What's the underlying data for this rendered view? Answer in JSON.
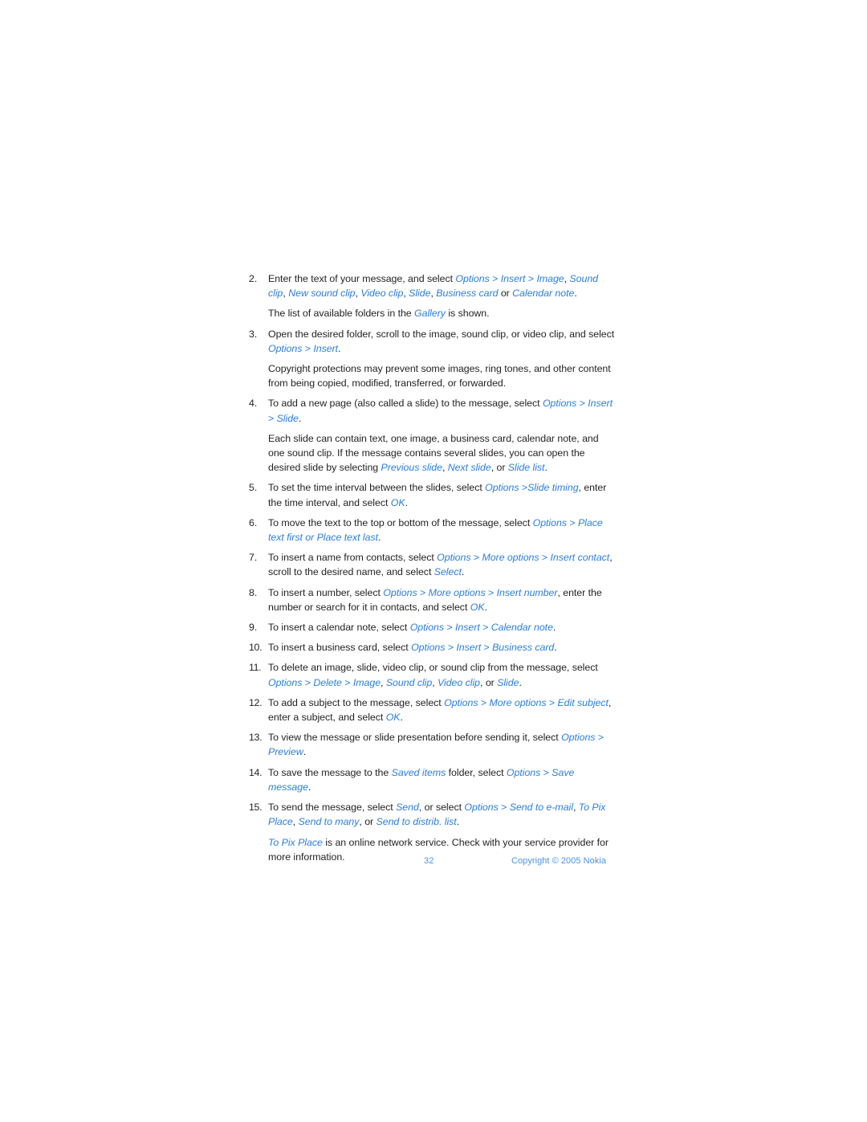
{
  "document": {
    "page_number": "32",
    "copyright": "Copyright © 2005 Nokia",
    "colors": {
      "body_text": "#231f20",
      "ui_term_blue": "#2b7fd8",
      "footer_blue": "#4b93e2",
      "background": "#ffffff"
    }
  },
  "steps": [
    {
      "number": "2.",
      "segments": [
        {
          "text": "Enter the text of your message, and select ",
          "style": "plain"
        },
        {
          "text": "Options",
          "style": "ui"
        },
        {
          "text": " > ",
          "style": "sep"
        },
        {
          "text": "Insert",
          "style": "ui"
        },
        {
          "text": " > ",
          "style": "sep"
        },
        {
          "text": "Image",
          "style": "ui"
        },
        {
          "text": ", ",
          "style": "plain"
        },
        {
          "text": "Sound clip",
          "style": "ui"
        },
        {
          "text": ", ",
          "style": "plain"
        },
        {
          "text": "New sound clip",
          "style": "ui"
        },
        {
          "text": ", ",
          "style": "plain"
        },
        {
          "text": "Video clip",
          "style": "ui"
        },
        {
          "text": ", ",
          "style": "plain"
        },
        {
          "text": "Slide",
          "style": "ui"
        },
        {
          "text": ", ",
          "style": "plain"
        },
        {
          "text": "Business card",
          "style": "ui"
        },
        {
          "text": " or ",
          "style": "plain"
        },
        {
          "text": "Calendar note",
          "style": "ui"
        },
        {
          "text": ".",
          "style": "plain"
        }
      ],
      "sub": [
        {
          "segments": [
            {
              "text": "The list of available folders in the ",
              "style": "plain"
            },
            {
              "text": "Gallery",
              "style": "ui"
            },
            {
              "text": " is shown.",
              "style": "plain"
            }
          ]
        }
      ]
    },
    {
      "number": "3.",
      "segments": [
        {
          "text": "Open the desired folder, scroll to the image, sound clip, or video clip, and select ",
          "style": "plain"
        },
        {
          "text": "Options",
          "style": "ui"
        },
        {
          "text": " > ",
          "style": "sep"
        },
        {
          "text": "Insert",
          "style": "ui"
        },
        {
          "text": ".",
          "style": "plain"
        }
      ],
      "sub": [
        {
          "segments": [
            {
              "text": "Copyright protections may prevent some images, ring tones, and other content from being copied, modified, transferred, or forwarded.",
              "style": "plain"
            }
          ]
        }
      ]
    },
    {
      "number": "4.",
      "segments": [
        {
          "text": "To add a new page (also called a slide) to the message, select ",
          "style": "plain"
        },
        {
          "text": "Options",
          "style": "ui"
        },
        {
          "text": " > ",
          "style": "sep"
        },
        {
          "text": "Insert",
          "style": "ui"
        },
        {
          "text": " > ",
          "style": "sep"
        },
        {
          "text": "Slide",
          "style": "ui"
        },
        {
          "text": ".",
          "style": "plain"
        }
      ],
      "sub": [
        {
          "segments": [
            {
              "text": "Each slide can contain text, one image, a business card, calendar note, and one sound clip. If the message contains several slides, you can open the desired slide by selecting ",
              "style": "plain"
            },
            {
              "text": "Previous slide",
              "style": "ui"
            },
            {
              "text": ", ",
              "style": "plain"
            },
            {
              "text": "Next slide",
              "style": "ui"
            },
            {
              "text": ", or ",
              "style": "plain"
            },
            {
              "text": "Slide list",
              "style": "ui"
            },
            {
              "text": ".",
              "style": "plain"
            }
          ]
        }
      ]
    },
    {
      "number": "5.",
      "segments": [
        {
          "text": "To set the time interval between the slides, select ",
          "style": "plain"
        },
        {
          "text": "Options",
          "style": "ui"
        },
        {
          "text": " >",
          "style": "sep"
        },
        {
          "text": "Slide timing",
          "style": "ui"
        },
        {
          "text": ", enter the time interval, and select ",
          "style": "plain"
        },
        {
          "text": "OK",
          "style": "ui"
        },
        {
          "text": ".",
          "style": "plain"
        }
      ],
      "sub": []
    },
    {
      "number": "6.",
      "segments": [
        {
          "text": "To move the text to the top or bottom of the message, select ",
          "style": "plain"
        },
        {
          "text": "Options",
          "style": "ui"
        },
        {
          "text": " > ",
          "style": "sep"
        },
        {
          "text": "Place text first or Place text last",
          "style": "ui"
        },
        {
          "text": ".",
          "style": "plain"
        }
      ],
      "sub": []
    },
    {
      "number": "7.",
      "segments": [
        {
          "text": "To insert a name from contacts, select ",
          "style": "plain"
        },
        {
          "text": "Options",
          "style": "ui"
        },
        {
          "text": " > ",
          "style": "sep"
        },
        {
          "text": "More options",
          "style": "ui"
        },
        {
          "text": " > ",
          "style": "sep"
        },
        {
          "text": "Insert contact",
          "style": "ui"
        },
        {
          "text": ", scroll to the desired name, and select ",
          "style": "plain"
        },
        {
          "text": "Select",
          "style": "ui"
        },
        {
          "text": ".",
          "style": "plain"
        }
      ],
      "sub": []
    },
    {
      "number": "8.",
      "segments": [
        {
          "text": "To insert a number, select ",
          "style": "plain"
        },
        {
          "text": "Options",
          "style": "ui"
        },
        {
          "text": " > ",
          "style": "sep"
        },
        {
          "text": "More options",
          "style": "ui"
        },
        {
          "text": " > ",
          "style": "sep"
        },
        {
          "text": "Insert number",
          "style": "ui"
        },
        {
          "text": ", enter the number or search for it in contacts, and select ",
          "style": "plain"
        },
        {
          "text": "OK",
          "style": "ui"
        },
        {
          "text": ".",
          "style": "plain"
        }
      ],
      "sub": []
    },
    {
      "number": "9.",
      "segments": [
        {
          "text": "To insert a calendar note, select ",
          "style": "plain"
        },
        {
          "text": "Options",
          "style": "ui"
        },
        {
          "text": " > ",
          "style": "sep"
        },
        {
          "text": "Insert",
          "style": "ui"
        },
        {
          "text": " > ",
          "style": "sep"
        },
        {
          "text": "Calendar note",
          "style": "ui"
        },
        {
          "text": ".",
          "style": "plain"
        }
      ],
      "sub": []
    },
    {
      "number": "10.",
      "segments": [
        {
          "text": "To insert a business card, select ",
          "style": "plain"
        },
        {
          "text": "Options",
          "style": "ui"
        },
        {
          "text": " > ",
          "style": "sep"
        },
        {
          "text": "Insert",
          "style": "ui"
        },
        {
          "text": " > ",
          "style": "sep"
        },
        {
          "text": "Business card",
          "style": "ui"
        },
        {
          "text": ".",
          "style": "plain"
        }
      ],
      "sub": []
    },
    {
      "number": "11.",
      "segments": [
        {
          "text": "To delete an image, slide, video clip, or sound clip from the message, select ",
          "style": "plain"
        },
        {
          "text": "Options",
          "style": "ui"
        },
        {
          "text": " > ",
          "style": "sep"
        },
        {
          "text": "Delete",
          "style": "ui"
        },
        {
          "text": " > ",
          "style": "sep"
        },
        {
          "text": "Image",
          "style": "ui"
        },
        {
          "text": ", ",
          "style": "plain"
        },
        {
          "text": "Sound clip",
          "style": "ui"
        },
        {
          "text": ", ",
          "style": "plain"
        },
        {
          "text": "Video clip",
          "style": "ui"
        },
        {
          "text": ", or ",
          "style": "plain"
        },
        {
          "text": "Slide",
          "style": "ui"
        },
        {
          "text": ".",
          "style": "plain"
        }
      ],
      "sub": []
    },
    {
      "number": "12.",
      "segments": [
        {
          "text": "To add a subject to the message, select ",
          "style": "plain"
        },
        {
          "text": "Options",
          "style": "ui"
        },
        {
          "text": " > ",
          "style": "sep"
        },
        {
          "text": "More options",
          "style": "ui"
        },
        {
          "text": " > ",
          "style": "sep"
        },
        {
          "text": "Edit subject",
          "style": "ui"
        },
        {
          "text": ", enter a subject, and select ",
          "style": "plain"
        },
        {
          "text": "OK",
          "style": "ui"
        },
        {
          "text": ".",
          "style": "plain"
        }
      ],
      "sub": []
    },
    {
      "number": "13.",
      "segments": [
        {
          "text": "To view the message or slide presentation before sending it, select ",
          "style": "plain"
        },
        {
          "text": "Options",
          "style": "ui"
        },
        {
          "text": " > ",
          "style": "sep"
        },
        {
          "text": "Preview",
          "style": "ui"
        },
        {
          "text": ".",
          "style": "plain"
        }
      ],
      "sub": []
    },
    {
      "number": "14.",
      "segments": [
        {
          "text": "To save the message to the ",
          "style": "plain"
        },
        {
          "text": "Saved items",
          "style": "ui"
        },
        {
          "text": " folder, select ",
          "style": "plain"
        },
        {
          "text": "Options",
          "style": "ui"
        },
        {
          "text": " > ",
          "style": "sep"
        },
        {
          "text": "Save message",
          "style": "ui"
        },
        {
          "text": ".",
          "style": "plain"
        }
      ],
      "sub": []
    },
    {
      "number": "15.",
      "segments": [
        {
          "text": "To send the message, select ",
          "style": "plain"
        },
        {
          "text": "Send",
          "style": "ui"
        },
        {
          "text": ", or select ",
          "style": "plain"
        },
        {
          "text": "Options",
          "style": "ui"
        },
        {
          "text": " > ",
          "style": "sep"
        },
        {
          "text": "Send to e-mail",
          "style": "ui"
        },
        {
          "text": ", ",
          "style": "plain"
        },
        {
          "text": "To Pix Place",
          "style": "ui"
        },
        {
          "text": ", ",
          "style": "plain"
        },
        {
          "text": "Send to many",
          "style": "ui"
        },
        {
          "text": ", or ",
          "style": "plain"
        },
        {
          "text": "Send to distrib. list",
          "style": "ui"
        },
        {
          "text": ".",
          "style": "plain"
        }
      ],
      "sub": [
        {
          "segments": [
            {
              "text": "To Pix Place",
              "style": "ui"
            },
            {
              "text": " is an online network service. Check with your service provider for more information.",
              "style": "plain"
            }
          ]
        }
      ]
    }
  ]
}
